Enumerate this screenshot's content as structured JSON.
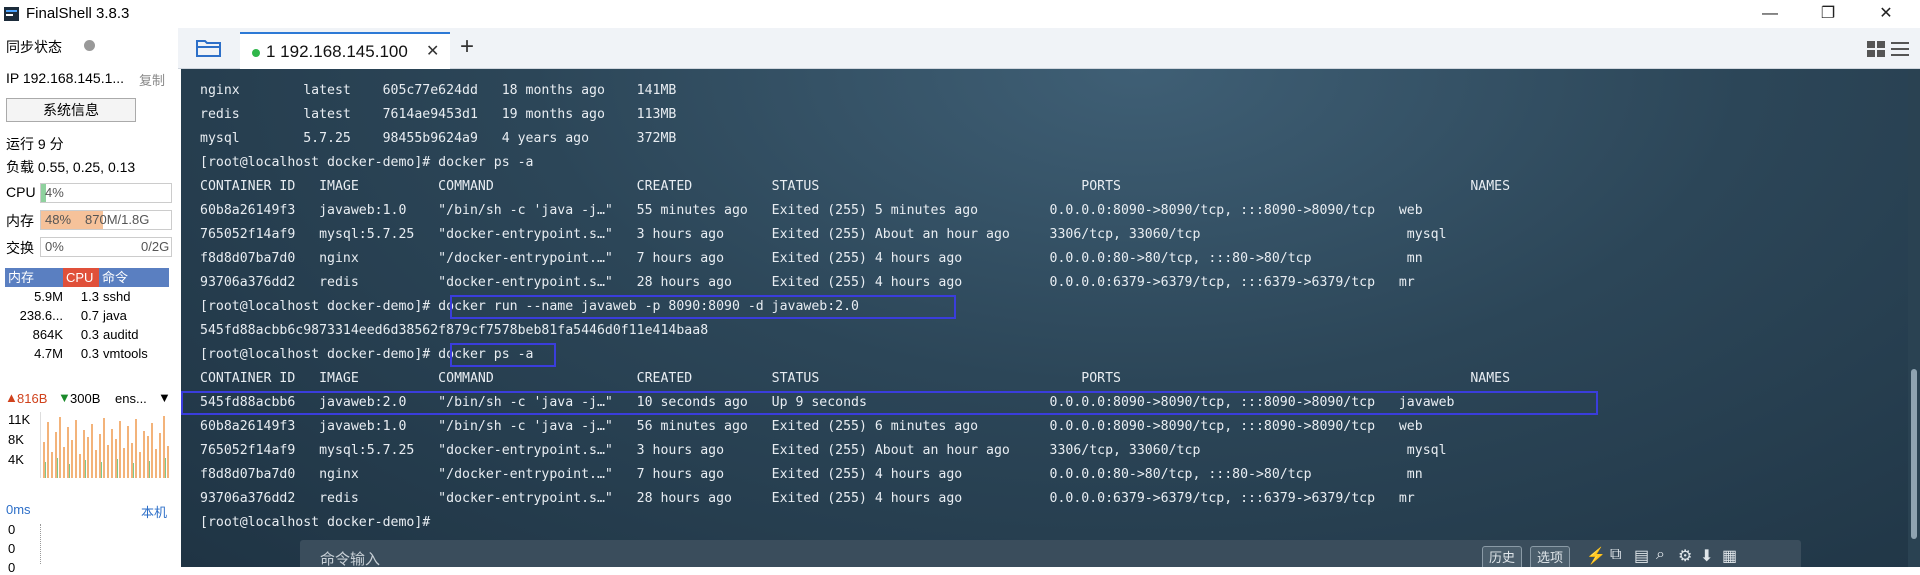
{
  "app": {
    "title": "FinalShell 3.8.3"
  },
  "window": {
    "minimize": "—",
    "restore": "❐",
    "close": "✕"
  },
  "sidebar": {
    "sync_label": "同步状态",
    "ip_label": "IP 192.168.145.1...",
    "copy_label": "复制",
    "sysinfo_button": "系统信息",
    "uptime": "运行 9 分",
    "load": "负载 0.55, 0.25, 0.13",
    "cpu": {
      "label": "CPU",
      "value": "4%",
      "percent": 4
    },
    "mem": {
      "label": "内存",
      "percent_text": "48%",
      "value": "870M/1.8G",
      "percent": 48
    },
    "swap": {
      "label": "交换",
      "percent_text": "0%",
      "value": "0/2G",
      "percent": 0
    },
    "proc_headers": [
      "内存",
      "CPU",
      "命令"
    ],
    "processes": [
      {
        "mem": "5.9M",
        "cpu": "1.3",
        "cmd": "sshd"
      },
      {
        "mem": "238.6...",
        "cpu": "0.7",
        "cmd": "java"
      },
      {
        "mem": "864K",
        "cpu": "0.3",
        "cmd": "auditd"
      },
      {
        "mem": "4.7M",
        "cpu": "0.3",
        "cmd": "vmtools"
      }
    ],
    "net": {
      "up": "816B",
      "down": "300B",
      "iface": "ens...",
      "ticks": [
        "11K",
        "8K",
        "4K"
      ]
    },
    "latency": {
      "value": "0ms",
      "host": "本机",
      "rows": [
        "0",
        "0",
        "0"
      ]
    }
  },
  "tabs": [
    {
      "label": "1 192.168.145.100",
      "active": true
    }
  ],
  "terminal": {
    "lines": [
      "nginx        latest    605c77e624dd   18 months ago    141MB",
      "redis        latest    7614ae9453d1   19 months ago    113MB",
      "mysql        5.7.25    98455b9624a9   4 years ago      372MB",
      "[root@localhost docker-demo]# docker ps -a",
      "CONTAINER ID   IMAGE          COMMAND                  CREATED          STATUS                                 PORTS                                            NAMES",
      "60b8a26149f3   javaweb:1.0    \"/bin/sh -c 'java -j…\"   55 minutes ago   Exited (255) 5 minutes ago         0.0.0.0:8090->8090/tcp, :::8090->8090/tcp   web",
      "765052f14af9   mysql:5.7.25   \"docker-entrypoint.s…\"   3 hours ago      Exited (255) About an hour ago     3306/tcp, 33060/tcp                          mysql",
      "f8d8d07ba7d0   nginx          \"/docker-entrypoint.…\"   7 hours ago      Exited (255) 4 hours ago           0.0.0.0:80->80/tcp, :::80->80/tcp            mn",
      "93706a376dd2   redis          \"docker-entrypoint.s…\"   28 hours ago     Exited (255) 4 hours ago           0.0.0.0:6379->6379/tcp, :::6379->6379/tcp   mr",
      "[root@localhost docker-demo]# docker run --name javaweb -p 8090:8090 -d javaweb:2.0",
      "545fd88acbb6c9873314eed6d38562f879cf7578beb81fa5446d0f11e414baa8",
      "[root@localhost docker-demo]# docker ps -a",
      "CONTAINER ID   IMAGE          COMMAND                  CREATED          STATUS                                 PORTS                                            NAMES",
      "545fd88acbb6   javaweb:2.0    \"/bin/sh -c 'java -j…\"   10 seconds ago   Up 9 seconds                       0.0.0.0:8090->8090/tcp, :::8090->8090/tcp   javaweb",
      "60b8a26149f3   javaweb:1.0    \"/bin/sh -c 'java -j…\"   56 minutes ago   Exited (255) 6 minutes ago         0.0.0.0:8090->8090/tcp, :::8090->8090/tcp   web",
      "765052f14af9   mysql:5.7.25   \"docker-entrypoint.s…\"   3 hours ago      Exited (255) About an hour ago     3306/tcp, 33060/tcp                          mysql",
      "f8d8d07ba7d0   nginx          \"/docker-entrypoint.…\"   7 hours ago      Exited (255) 4 hours ago           0.0.0.0:80->80/tcp, :::80->80/tcp            mn",
      "93706a376dd2   redis          \"docker-entrypoint.s…\"   28 hours ago     Exited (255) 4 hours ago           0.0.0.0:6379->6379/tcp, :::6379->6379/tcp   mr",
      "[root@localhost docker-demo]#"
    ]
  },
  "cmdbar": {
    "placeholder": "命令输入",
    "history": "历史",
    "options": "选项"
  },
  "colors": {
    "accent": "#2d7ad6",
    "highlight": "#3a3ddc",
    "online": "#2fb64a"
  }
}
